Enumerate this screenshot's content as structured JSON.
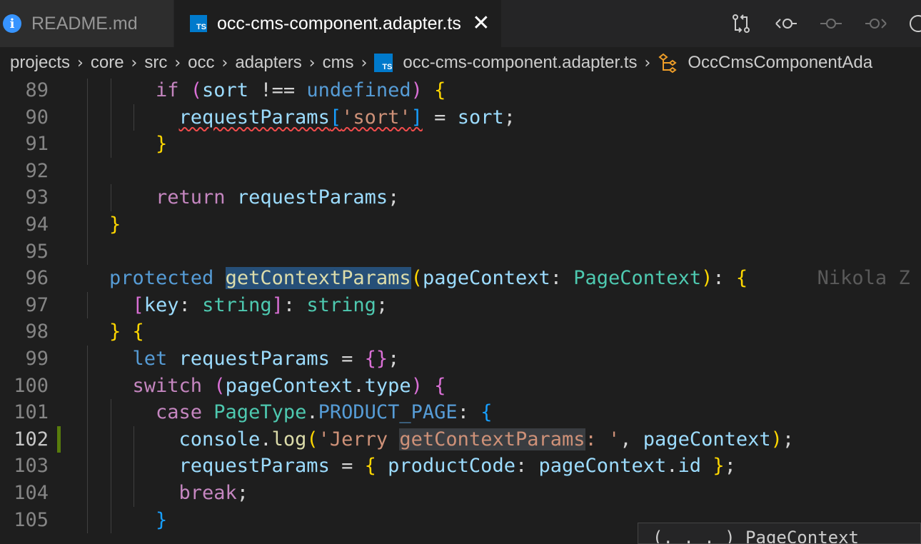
{
  "tabs": [
    {
      "label": "README.md",
      "icon": "info-icon",
      "active": false
    },
    {
      "label": "occ-cms-component.adapter.ts",
      "icon": "typescript-file-icon",
      "active": true,
      "close": "✕"
    }
  ],
  "ts_badge": "TS",
  "info_glyph": "i",
  "breadcrumb": {
    "items": [
      "projects",
      "core",
      "src",
      "occ",
      "adapters",
      "cms",
      "occ-cms-component.adapter.ts",
      "OccCmsComponentAda"
    ],
    "separator": "›"
  },
  "editor": {
    "line_numbers": [
      "89",
      "90",
      "91",
      "92",
      "93",
      "94",
      "95",
      "96",
      "97",
      "98",
      "99",
      "100",
      "101",
      "102",
      "103",
      "104",
      "105"
    ],
    "active_line": "102",
    "blame": "Nikola Z",
    "hover_text": "(. . . ) PageContext"
  },
  "code_lines": [
    [
      {
        "t": "if",
        "c": "k"
      },
      {
        "t": " (",
        "c": "b2"
      },
      {
        "t": "sort",
        "c": "v"
      },
      {
        "t": " !== ",
        "c": "p"
      },
      {
        "t": "undefined",
        "c": "s"
      },
      {
        "t": ")",
        "c": "b2"
      },
      {
        "t": " {",
        "c": "b1"
      }
    ],
    [
      {
        "t": "requestParams",
        "c": "v"
      },
      {
        "t": "[",
        "c": "b3"
      },
      {
        "t": "'sort'",
        "c": "st"
      },
      {
        "t": "]",
        "c": "b3"
      },
      {
        "t": " = ",
        "c": "p"
      },
      {
        "t": "sort",
        "c": "v"
      },
      {
        "t": ";",
        "c": "p"
      }
    ],
    [
      {
        "t": "}",
        "c": "b1"
      }
    ],
    [],
    [
      {
        "t": "return",
        "c": "k"
      },
      {
        "t": " ",
        "c": "p"
      },
      {
        "t": "requestParams",
        "c": "v"
      },
      {
        "t": ";",
        "c": "p"
      }
    ],
    [
      {
        "t": "}",
        "c": "b1"
      }
    ],
    [],
    [
      {
        "t": "protected",
        "c": "s"
      },
      {
        "t": " ",
        "c": "p"
      },
      {
        "t": "getContextParams",
        "c": "f"
      },
      {
        "t": "(",
        "c": "b1"
      },
      {
        "t": "pageContext",
        "c": "v"
      },
      {
        "t": ": ",
        "c": "p"
      },
      {
        "t": "PageContext",
        "c": "t"
      },
      {
        "t": ")",
        "c": "b1"
      },
      {
        "t": ": ",
        "c": "p"
      },
      {
        "t": "{",
        "c": "b1"
      }
    ],
    [
      {
        "t": "[",
        "c": "b2"
      },
      {
        "t": "key",
        "c": "v"
      },
      {
        "t": ": ",
        "c": "p"
      },
      {
        "t": "string",
        "c": "t"
      },
      {
        "t": "]",
        "c": "b2"
      },
      {
        "t": ": ",
        "c": "p"
      },
      {
        "t": "string",
        "c": "t"
      },
      {
        "t": ";",
        "c": "p"
      }
    ],
    [
      {
        "t": "}",
        "c": "b1"
      },
      {
        "t": " {",
        "c": "b1"
      }
    ],
    [
      {
        "t": "let",
        "c": "s"
      },
      {
        "t": " ",
        "c": "p"
      },
      {
        "t": "requestParams",
        "c": "v"
      },
      {
        "t": " = ",
        "c": "p"
      },
      {
        "t": "{}",
        "c": "b2"
      },
      {
        "t": ";",
        "c": "p"
      }
    ],
    [
      {
        "t": "switch",
        "c": "k"
      },
      {
        "t": " ",
        "c": "p"
      },
      {
        "t": "(",
        "c": "b2"
      },
      {
        "t": "pageContext",
        "c": "v"
      },
      {
        "t": ".",
        "c": "p"
      },
      {
        "t": "type",
        "c": "v"
      },
      {
        "t": ")",
        "c": "b2"
      },
      {
        "t": " {",
        "c": "b2"
      }
    ],
    [
      {
        "t": "case",
        "c": "k"
      },
      {
        "t": " ",
        "c": "p"
      },
      {
        "t": "PageType",
        "c": "t"
      },
      {
        "t": ".",
        "c": "p"
      },
      {
        "t": "PRODUCT_PAGE",
        "c": "s"
      },
      {
        "t": ": ",
        "c": "p"
      },
      {
        "t": "{",
        "c": "b3"
      }
    ],
    [
      {
        "t": "console",
        "c": "v"
      },
      {
        "t": ".",
        "c": "p"
      },
      {
        "t": "log",
        "c": "f"
      },
      {
        "t": "(",
        "c": "b1"
      },
      {
        "t": "'Jerry ",
        "c": "st"
      },
      {
        "t": "getContextParams",
        "c": "st"
      },
      {
        "t": ": '",
        "c": "st"
      },
      {
        "t": ", ",
        "c": "p"
      },
      {
        "t": "pageContext",
        "c": "v"
      },
      {
        "t": ")",
        "c": "b1"
      },
      {
        "t": ";",
        "c": "p"
      }
    ],
    [
      {
        "t": "requestParams",
        "c": "v"
      },
      {
        "t": " = ",
        "c": "p"
      },
      {
        "t": "{",
        "c": "b1"
      },
      {
        "t": " ",
        "c": "p"
      },
      {
        "t": "productCode",
        "c": "v"
      },
      {
        "t": ": ",
        "c": "p"
      },
      {
        "t": "pageContext",
        "c": "v"
      },
      {
        "t": ".",
        "c": "p"
      },
      {
        "t": "id",
        "c": "v"
      },
      {
        "t": " ",
        "c": "p"
      },
      {
        "t": "}",
        "c": "b1"
      },
      {
        "t": ";",
        "c": "p"
      }
    ],
    [
      {
        "t": "break",
        "c": "k"
      },
      {
        "t": ";",
        "c": "p"
      }
    ],
    [
      {
        "t": "}",
        "c": "b3"
      }
    ]
  ]
}
